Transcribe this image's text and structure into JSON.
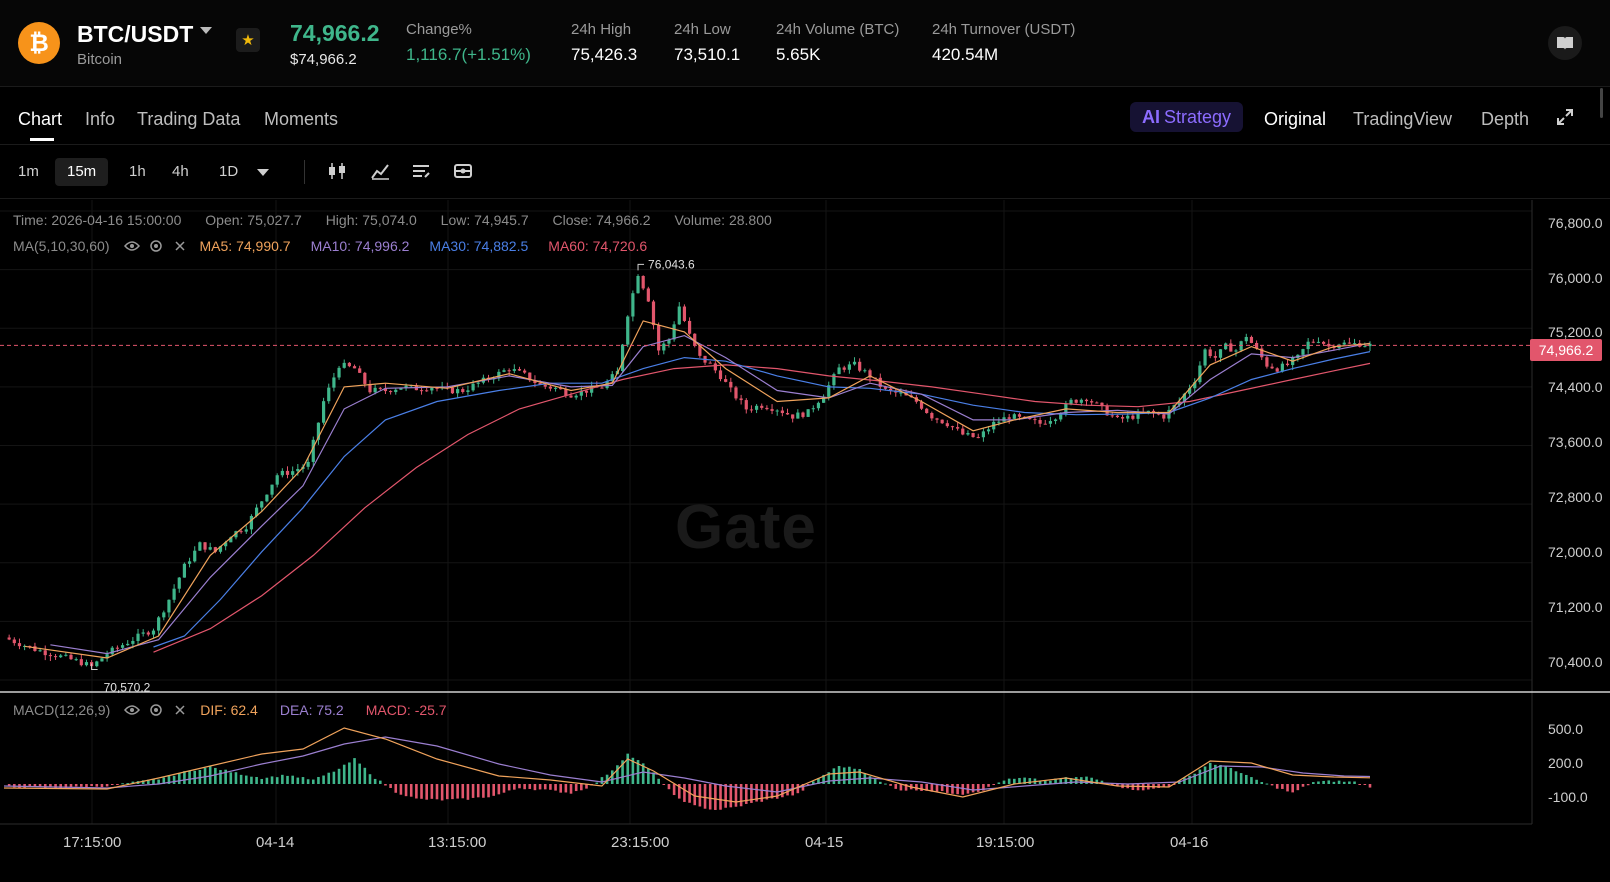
{
  "header": {
    "coin_symbol": "₿",
    "pair": "BTC/USDT",
    "name": "Bitcoin",
    "last_price": "74,966.2",
    "last_price_sub": "$74,966.2",
    "stats": [
      {
        "label": "Change%",
        "value": "1,116.7(+1.51%)",
        "positive": true
      },
      {
        "label": "24h High",
        "value": "75,426.3"
      },
      {
        "label": "24h Low",
        "value": "73,510.1"
      },
      {
        "label": "24h Volume (BTC)",
        "value": "5.65K"
      },
      {
        "label": "24h Turnover (USDT)",
        "value": "420.54M"
      }
    ]
  },
  "tabs": {
    "left": [
      "Chart",
      "Info",
      "Trading Data",
      "Moments"
    ],
    "active": "Chart",
    "strategy": "Strategy",
    "strategy_prefix": "AI",
    "right": [
      "Original",
      "TradingView",
      "Depth"
    ],
    "right_selected": "Original"
  },
  "toolbar": {
    "timeframes": [
      "1m",
      "15m",
      "1h",
      "4h",
      "1D"
    ],
    "selected": "15m",
    "tools": [
      "candlestick-icon",
      "indicator-icon",
      "settings-lines-icon",
      "drawing-icon"
    ]
  },
  "ohlc": {
    "time": "Time: 2026-04-16 15:00:00",
    "open": "Open: 75,027.7",
    "high": "High: 75,074.0",
    "low": "Low: 74,945.7",
    "close": "Close: 74,966.2",
    "volume": "Volume: 28.800"
  },
  "ma_legend": {
    "label": "MA(5,10,30,60)",
    "ma5": "MA5: 74,990.7",
    "ma10": "MA10: 74,996.2",
    "ma30": "MA30: 74,882.5",
    "ma60": "MA60: 74,720.6"
  },
  "macd_legend": {
    "label": "MACD(12,26,9)",
    "dif": "DIF: 62.4",
    "dea": "DEA: 75.2",
    "macd": "MACD: -25.7"
  },
  "chart_data": {
    "type": "candlestick",
    "instrument": "BTC/USDT",
    "interval": "15m",
    "y_ticks": [
      "76,800.0",
      "76,000.0",
      "75,200.0",
      "74,400.0",
      "73,600.0",
      "72,800.0",
      "72,000.0",
      "71,200.0",
      "70,400.0"
    ],
    "ylim": [
      70250,
      76950
    ],
    "macd_ticks": [
      "500.0",
      "200.0",
      "-100.0"
    ],
    "macd_ylim": [
      -400,
      850
    ],
    "x_ticks": [
      "17:15:00",
      "04-14",
      "13:15:00",
      "23:15:00",
      "04-15",
      "19:15:00",
      "04-16"
    ],
    "current_price": "74,966.2",
    "max_marker": "76,043.6",
    "min_marker": "70,570.2",
    "watermark": "Gate",
    "colors": {
      "up": "#3fb68b",
      "down": "#e2566c",
      "ma5": "#f0a35c",
      "ma10": "#9b7fd0",
      "ma30": "#4a7fe6",
      "ma60": "#e2566c",
      "dif": "#f0a35c",
      "dea": "#9b7fd0"
    },
    "price_path": [
      [
        0,
        70980
      ],
      [
        3,
        70900
      ],
      [
        6,
        70820
      ],
      [
        9,
        70760
      ],
      [
        12,
        70700
      ],
      [
        15,
        70640
      ],
      [
        17,
        70580
      ],
      [
        20,
        70760
      ],
      [
        23,
        70880
      ],
      [
        26,
        70990
      ],
      [
        29,
        71100
      ],
      [
        32,
        71500
      ],
      [
        35,
        71950
      ],
      [
        38,
        72250
      ],
      [
        41,
        72150
      ],
      [
        44,
        72380
      ],
      [
        47,
        72500
      ],
      [
        50,
        72850
      ],
      [
        53,
        73200
      ],
      [
        56,
        73250
      ],
      [
        59,
        73350
      ],
      [
        62,
        74200
      ],
      [
        65,
        74700
      ],
      [
        68,
        74650
      ],
      [
        71,
        74350
      ],
      [
        74,
        74350
      ],
      [
        77,
        74400
      ],
      [
        80,
        74380
      ],
      [
        83,
        74400
      ],
      [
        86,
        74350
      ],
      [
        89,
        74350
      ],
      [
        92,
        74450
      ],
      [
        95,
        74550
      ],
      [
        98,
        74650
      ],
      [
        101,
        74560
      ],
      [
        104,
        74420
      ],
      [
        107,
        74380
      ],
      [
        110,
        74300
      ],
      [
        113,
        74350
      ],
      [
        116,
        74400
      ],
      [
        119,
        74600
      ],
      [
        121,
        75400
      ],
      [
        123,
        75950
      ],
      [
        125,
        75600
      ],
      [
        127,
        74900
      ],
      [
        129,
        75050
      ],
      [
        131,
        75500
      ],
      [
        133,
        75100
      ],
      [
        135,
        74800
      ],
      [
        137,
        74700
      ],
      [
        139,
        74550
      ],
      [
        141,
        74350
      ],
      [
        144,
        74100
      ],
      [
        147,
        74150
      ],
      [
        150,
        74100
      ],
      [
        153,
        74000
      ],
      [
        156,
        74050
      ],
      [
        159,
        74300
      ],
      [
        162,
        74650
      ],
      [
        165,
        74700
      ],
      [
        168,
        74550
      ],
      [
        171,
        74350
      ],
      [
        174,
        74300
      ],
      [
        177,
        74200
      ],
      [
        180,
        74000
      ],
      [
        183,
        73900
      ],
      [
        186,
        73750
      ],
      [
        189,
        73700
      ],
      [
        192,
        73900
      ],
      [
        195,
        74000
      ],
      [
        198,
        73950
      ],
      [
        201,
        73900
      ],
      [
        204,
        74000
      ],
      [
        207,
        74200
      ],
      [
        210,
        74250
      ],
      [
        213,
        74100
      ],
      [
        216,
        73950
      ],
      [
        219,
        74000
      ],
      [
        222,
        74050
      ],
      [
        225,
        74000
      ],
      [
        228,
        74200
      ],
      [
        231,
        74500
      ],
      [
        233,
        74900
      ],
      [
        235,
        74800
      ],
      [
        237,
        74950
      ],
      [
        239,
        74900
      ],
      [
        241,
        75100
      ],
      [
        243,
        74900
      ],
      [
        245,
        74700
      ],
      [
        247,
        74650
      ],
      [
        249,
        74700
      ],
      [
        251,
        74800
      ],
      [
        253,
        75000
      ],
      [
        255,
        75050
      ],
      [
        257,
        74950
      ],
      [
        259,
        75000
      ],
      [
        261,
        74980
      ],
      [
        263,
        74990
      ],
      [
        265,
        74966
      ]
    ],
    "ma5": [
      [
        4,
        70860
      ],
      [
        20,
        70700
      ],
      [
        30,
        71000
      ],
      [
        40,
        72100
      ],
      [
        50,
        72700
      ],
      [
        58,
        73300
      ],
      [
        66,
        74400
      ],
      [
        74,
        74450
      ],
      [
        86,
        74380
      ],
      [
        98,
        74580
      ],
      [
        110,
        74350
      ],
      [
        118,
        74450
      ],
      [
        124,
        75300
      ],
      [
        132,
        75150
      ],
      [
        140,
        74650
      ],
      [
        150,
        74200
      ],
      [
        160,
        74250
      ],
      [
        168,
        74550
      ],
      [
        178,
        74200
      ],
      [
        188,
        73800
      ],
      [
        196,
        73950
      ],
      [
        206,
        74100
      ],
      [
        216,
        74050
      ],
      [
        226,
        74050
      ],
      [
        234,
        74700
      ],
      [
        242,
        74950
      ],
      [
        250,
        74750
      ],
      [
        258,
        74950
      ],
      [
        265,
        74990
      ]
    ],
    "ma10": [
      [
        9,
        70880
      ],
      [
        20,
        70760
      ],
      [
        30,
        70950
      ],
      [
        40,
        71800
      ],
      [
        50,
        72500
      ],
      [
        58,
        73050
      ],
      [
        66,
        74100
      ],
      [
        74,
        74380
      ],
      [
        86,
        74400
      ],
      [
        98,
        74550
      ],
      [
        110,
        74400
      ],
      [
        118,
        74420
      ],
      [
        124,
        74950
      ],
      [
        132,
        75100
      ],
      [
        140,
        74800
      ],
      [
        150,
        74350
      ],
      [
        160,
        74250
      ],
      [
        168,
        74450
      ],
      [
        178,
        74300
      ],
      [
        188,
        73950
      ],
      [
        196,
        73950
      ],
      [
        206,
        74050
      ],
      [
        216,
        74080
      ],
      [
        226,
        74030
      ],
      [
        234,
        74500
      ],
      [
        242,
        74850
      ],
      [
        250,
        74800
      ],
      [
        258,
        74900
      ],
      [
        265,
        74996
      ]
    ],
    "ma30": [
      [
        29,
        70850
      ],
      [
        35,
        71000
      ],
      [
        42,
        71500
      ],
      [
        50,
        72150
      ],
      [
        58,
        72750
      ],
      [
        66,
        73450
      ],
      [
        74,
        73950
      ],
      [
        84,
        74200
      ],
      [
        96,
        74350
      ],
      [
        106,
        74450
      ],
      [
        116,
        74450
      ],
      [
        124,
        74650
      ],
      [
        132,
        74800
      ],
      [
        140,
        74750
      ],
      [
        150,
        74550
      ],
      [
        160,
        74400
      ],
      [
        168,
        74380
      ],
      [
        178,
        74300
      ],
      [
        188,
        74150
      ],
      [
        198,
        74050
      ],
      [
        208,
        74020
      ],
      [
        218,
        74030
      ],
      [
        226,
        74050
      ],
      [
        234,
        74250
      ],
      [
        242,
        74500
      ],
      [
        250,
        74650
      ],
      [
        258,
        74780
      ],
      [
        265,
        74882
      ]
    ],
    "ma60": [
      [
        29,
        70780
      ],
      [
        40,
        71100
      ],
      [
        50,
        71550
      ],
      [
        60,
        72100
      ],
      [
        70,
        72750
      ],
      [
        80,
        73300
      ],
      [
        90,
        73750
      ],
      [
        100,
        74100
      ],
      [
        110,
        74300
      ],
      [
        120,
        74500
      ],
      [
        130,
        74650
      ],
      [
        140,
        74700
      ],
      [
        150,
        74650
      ],
      [
        160,
        74550
      ],
      [
        170,
        74480
      ],
      [
        180,
        74400
      ],
      [
        190,
        74300
      ],
      [
        200,
        74200
      ],
      [
        210,
        74150
      ],
      [
        220,
        74130
      ],
      [
        230,
        74200
      ],
      [
        240,
        74350
      ],
      [
        250,
        74500
      ],
      [
        258,
        74620
      ],
      [
        265,
        74720
      ]
    ],
    "macd_hist": [
      [
        0,
        -30
      ],
      [
        10,
        -40
      ],
      [
        20,
        -20
      ],
      [
        30,
        50
      ],
      [
        35,
        120
      ],
      [
        40,
        170
      ],
      [
        45,
        110
      ],
      [
        50,
        60
      ],
      [
        55,
        90
      ],
      [
        60,
        40
      ],
      [
        65,
        150
      ],
      [
        68,
        250
      ],
      [
        72,
        60
      ],
      [
        76,
        -80
      ],
      [
        80,
        -150
      ],
      [
        85,
        -160
      ],
      [
        90,
        -150
      ],
      [
        95,
        -120
      ],
      [
        100,
        -40
      ],
      [
        105,
        -60
      ],
      [
        110,
        -90
      ],
      [
        114,
        -20
      ],
      [
        118,
        140
      ],
      [
        121,
        300
      ],
      [
        124,
        200
      ],
      [
        127,
        60
      ],
      [
        130,
        -120
      ],
      [
        134,
        -220
      ],
      [
        138,
        -260
      ],
      [
        142,
        -230
      ],
      [
        146,
        -180
      ],
      [
        150,
        -140
      ],
      [
        154,
        -100
      ],
      [
        158,
        60
      ],
      [
        162,
        180
      ],
      [
        166,
        150
      ],
      [
        170,
        20
      ],
      [
        174,
        -60
      ],
      [
        178,
        -60
      ],
      [
        182,
        -80
      ],
      [
        186,
        -100
      ],
      [
        190,
        -60
      ],
      [
        194,
        40
      ],
      [
        198,
        60
      ],
      [
        202,
        30
      ],
      [
        206,
        60
      ],
      [
        210,
        70
      ],
      [
        214,
        20
      ],
      [
        218,
        -50
      ],
      [
        222,
        -60
      ],
      [
        226,
        -20
      ],
      [
        230,
        80
      ],
      [
        234,
        210
      ],
      [
        238,
        160
      ],
      [
        242,
        60
      ],
      [
        246,
        -20
      ],
      [
        250,
        -90
      ],
      [
        254,
        20
      ],
      [
        258,
        30
      ],
      [
        262,
        20
      ],
      [
        265,
        -26
      ]
    ],
    "dif": [
      [
        0,
        -40
      ],
      [
        20,
        -50
      ],
      [
        30,
        60
      ],
      [
        40,
        180
      ],
      [
        50,
        300
      ],
      [
        58,
        350
      ],
      [
        66,
        560
      ],
      [
        74,
        450
      ],
      [
        84,
        250
      ],
      [
        96,
        80
      ],
      [
        106,
        40
      ],
      [
        116,
        -20
      ],
      [
        121,
        250
      ],
      [
        126,
        130
      ],
      [
        134,
        -120
      ],
      [
        142,
        -180
      ],
      [
        150,
        -120
      ],
      [
        160,
        100
      ],
      [
        166,
        120
      ],
      [
        176,
        -30
      ],
      [
        186,
        -130
      ],
      [
        196,
        0
      ],
      [
        206,
        60
      ],
      [
        216,
        -20
      ],
      [
        226,
        -30
      ],
      [
        234,
        230
      ],
      [
        242,
        210
      ],
      [
        250,
        90
      ],
      [
        258,
        70
      ],
      [
        265,
        62
      ]
    ],
    "dea": [
      [
        0,
        -20
      ],
      [
        20,
        -40
      ],
      [
        30,
        0
      ],
      [
        40,
        80
      ],
      [
        50,
        200
      ],
      [
        58,
        280
      ],
      [
        66,
        400
      ],
      [
        74,
        470
      ],
      [
        84,
        380
      ],
      [
        96,
        200
      ],
      [
        106,
        90
      ],
      [
        116,
        20
      ],
      [
        124,
        120
      ],
      [
        132,
        60
      ],
      [
        140,
        -20
      ],
      [
        150,
        -80
      ],
      [
        160,
        30
      ],
      [
        168,
        60
      ],
      [
        178,
        20
      ],
      [
        188,
        -60
      ],
      [
        198,
        -20
      ],
      [
        208,
        20
      ],
      [
        218,
        0
      ],
      [
        228,
        20
      ],
      [
        236,
        180
      ],
      [
        244,
        170
      ],
      [
        252,
        110
      ],
      [
        260,
        80
      ],
      [
        265,
        75
      ]
    ]
  }
}
